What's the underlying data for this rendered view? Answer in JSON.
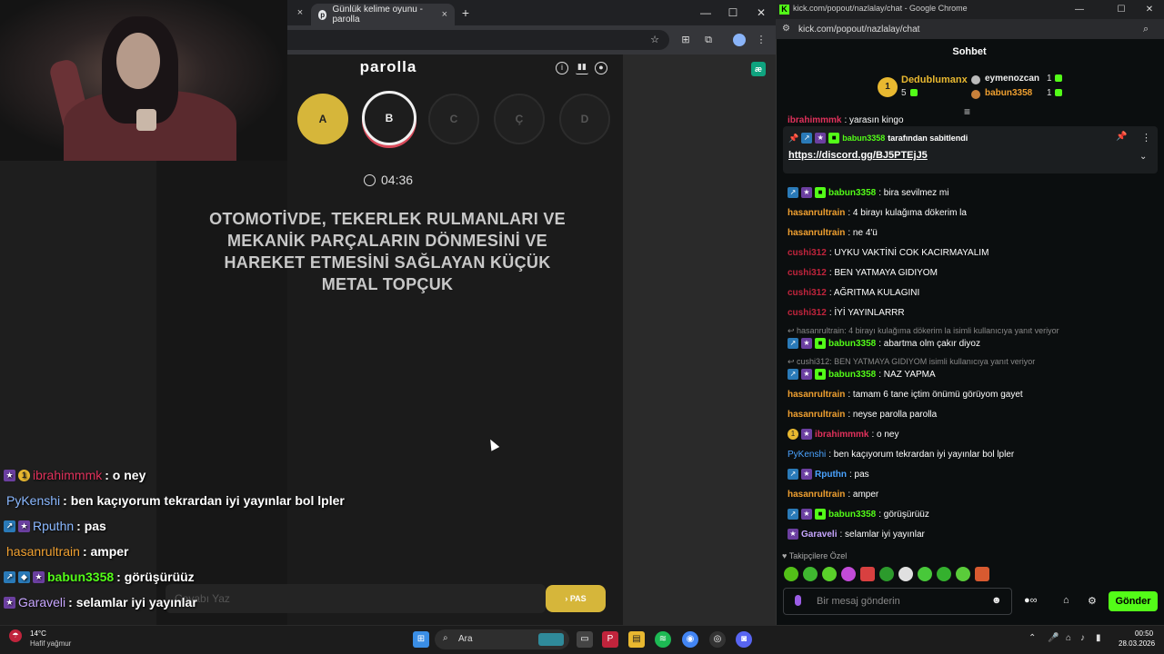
{
  "browser": {
    "active_tab_title": "Günlük kelime oyunu - parolla",
    "tab_close": "×",
    "new_tab": "+",
    "win_min": "—",
    "win_max": "☐",
    "win_close": "✕"
  },
  "parolla": {
    "title": "parolla",
    "letters": [
      {
        "label": "A",
        "state": "done"
      },
      {
        "label": "B",
        "state": "active"
      },
      {
        "label": "C",
        "state": "pending"
      },
      {
        "label": "Ç",
        "state": "pending"
      },
      {
        "label": "D",
        "state": "pending"
      }
    ],
    "timer": "04:36",
    "question": "OTOMOTİVDE, TEKERLEK RULMANLARI VE MEKANİK PARÇALARIN DÖNMESİNİ VE HAREKET ETMESİNİ SAĞLAYAN KÜÇÜK METAL TOPÇUK",
    "answer_placeholder": "Cevabı Yaz",
    "pass_button": "› PAS"
  },
  "overlay_chat": [
    {
      "user": "ibrahimmmk",
      "msg": ": o ney",
      "color": "#e0315b"
    },
    {
      "user": "PyKenshi",
      "msg": ": ben kaçıyorum tekrardan iyi yayınlar bol lpler",
      "color": "#4aa3ff"
    },
    {
      "user": "Rputhn",
      "msg": ": pas",
      "color": "#4aa3ff"
    },
    {
      "user": "hasanrultrain",
      "msg": ": amper",
      "color": "#f0a030"
    },
    {
      "user": "babun3358",
      "msg": ": görüşürüüz",
      "color": "#53fc18"
    },
    {
      "user": "Garaveli",
      "msg": ": selamlar iyi yayınlar",
      "color": "#c7a6ff"
    }
  ],
  "kick": {
    "window_title": "kick.com/popout/nazlalay/chat - Google Chrome",
    "url": "kick.com/popout/nazlalay/chat",
    "header": "Sohbet",
    "leaderboard": {
      "first": {
        "name": "Dedublumanx",
        "count": "5",
        "rank": "1"
      },
      "second": {
        "name": "eymenozcan",
        "count": "1"
      },
      "third": {
        "name": "babun3358",
        "count": "1"
      }
    },
    "pinned": {
      "by": "babun3358",
      "suffix": "tarafından sabitlendi",
      "link": "https://discord.gg/BJ5PTEjJ5",
      "above_user": "ibrahimmmk",
      "above_msg": ": yarasın kingo"
    },
    "messages": [
      {
        "user": "babun3358",
        "msg": ": bira sevilmez mi",
        "color": "#53fc18"
      },
      {
        "user": "hasanrultrain",
        "msg": ": 4 birayı kulağıma dökerim la",
        "color": "#f0a030"
      },
      {
        "user": "hasanrultrain",
        "msg": ": ne 4'ü",
        "color": "#f0a030"
      },
      {
        "user": "cushi312",
        "msg": ": UYKU VAKTİNİ COK KACIRMAYALIM",
        "color": "#c0243c"
      },
      {
        "user": "cushi312",
        "msg": ": BEN YATMAYA GIDIYOM",
        "color": "#c0243c"
      },
      {
        "user": "cushi312",
        "msg": ": AĞRITMA KULAGINI",
        "color": "#c0243c"
      },
      {
        "user": "cushi312",
        "msg": ": İYİ YAYINLARRR",
        "color": "#c0243c"
      },
      {
        "user": "babun3358",
        "msg": ": abartma olm çakır diyoz",
        "color": "#53fc18",
        "reply": "hasanrultrain: 4 birayı kulağıma dökerim la isimli kullanıcıya yanıt veriyor"
      },
      {
        "user": "babun3358",
        "msg": ": NAZ YAPMA",
        "color": "#53fc18",
        "reply": "cushi312: BEN YATMAYA GIDIYOM isimli kullanıcıya yanıt veriyor"
      },
      {
        "user": "hasanrultrain",
        "msg": ": tamam 6 tane içtim önümü görüyom gayet",
        "color": "#f0a030"
      },
      {
        "user": "hasanrultrain",
        "msg": ": neyse parolla parolla",
        "color": "#f0a030"
      },
      {
        "user": "ibrahimmmk",
        "msg": ": o ney",
        "color": "#e0315b"
      },
      {
        "user": "PyKenshi",
        "msg": ": ben kaçıyorum tekrardan iyi yayınlar bol lpler",
        "color": "#4aa3ff"
      },
      {
        "user": "Rputhn",
        "msg": ": pas",
        "color": "#4aa3ff"
      },
      {
        "user": "hasanrultrain",
        "msg": ": amper",
        "color": "#f0a030"
      },
      {
        "user": "babun3358",
        "msg": ": görüşürüüz",
        "color": "#53fc18"
      },
      {
        "user": "Garaveli",
        "msg": ": selamlar iyi yayınlar",
        "color": "#c7a6ff"
      }
    ],
    "followers_only": "Takipçilere Özel",
    "input_placeholder": "Bir mesaj gönderin",
    "send": "Gönder"
  },
  "taskbar": {
    "weather_temp": "14°C",
    "weather_desc": "Hafif yağmur",
    "search": "Ara",
    "time": "00:50",
    "date": "28.03.2026"
  }
}
